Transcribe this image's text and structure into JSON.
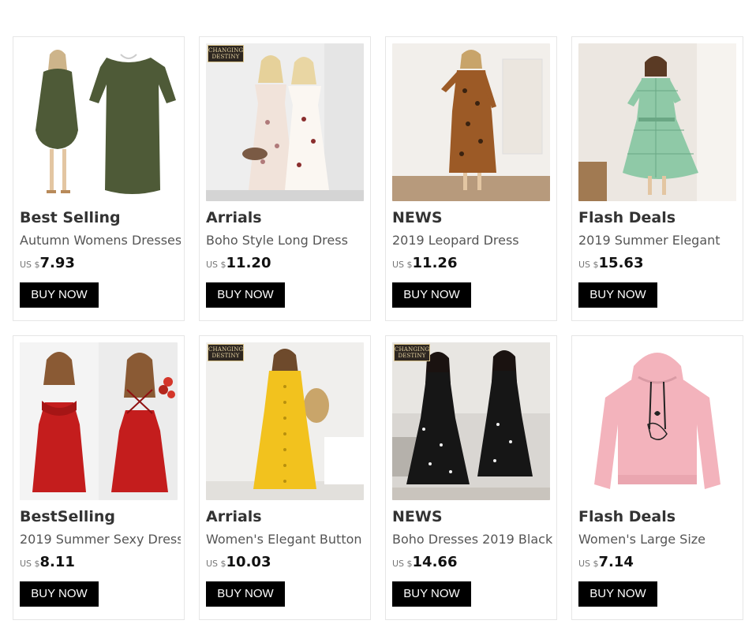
{
  "products": [
    {
      "category": "Best Selling",
      "title": "Autumn Womens Dresses",
      "currency": "US $",
      "price": "7.93",
      "button": "BUY NOW",
      "watermark": "",
      "image": "olive-dress-photo",
      "colors": {
        "bg": "#ffffff",
        "garment": "#4e5a37"
      }
    },
    {
      "category": "Arrials",
      "title": "Boho Style Long Dress",
      "currency": "US $",
      "price": "11.20",
      "button": "BUY NOW",
      "watermark": "CHANGING DESTINY",
      "image": "boho-dress-photo",
      "colors": {
        "bg": "#eeeeee",
        "garment": "#f1e3da"
      }
    },
    {
      "category": "NEWS",
      "title": "2019 Leopard Dress",
      "currency": "US $",
      "price": "11.26",
      "button": "BUY NOW",
      "watermark": "",
      "image": "leopard-dress-photo",
      "colors": {
        "bg": "#f2efeb",
        "garment": "#9c5a26"
      }
    },
    {
      "category": "Flash Deals",
      "title": "2019 Summer Elegant",
      "currency": "US $",
      "price": "15.63",
      "button": "BUY NOW",
      "watermark": "",
      "image": "plaid-dress-photo",
      "colors": {
        "bg": "#ece7e1",
        "garment": "#8fc9a7"
      }
    },
    {
      "category": "BestSelling",
      "title": "2019 Summer Sexy Dress",
      "currency": "US $",
      "price": "8.11",
      "button": "BUY NOW",
      "watermark": "",
      "image": "red-dress-photo",
      "colors": {
        "bg": "#ececec",
        "garment": "#c41d1d"
      }
    },
    {
      "category": "Arrials",
      "title": "Women's Elegant Button",
      "currency": "US $",
      "price": "10.03",
      "button": "BUY NOW",
      "watermark": "CHANGING DESTINY",
      "image": "yellow-dress-photo",
      "colors": {
        "bg": "#f0efed",
        "garment": "#f2c21e"
      }
    },
    {
      "category": "NEWS",
      "title": "Boho Dresses 2019 Black",
      "currency": "US $",
      "price": "14.66",
      "button": "BUY NOW",
      "watermark": "CHANGING DESTINY",
      "image": "black-floral-dress-photo",
      "colors": {
        "bg": "#d9d6d2",
        "garment": "#161616"
      }
    },
    {
      "category": "Flash Deals",
      "title": "Women's Large Size",
      "currency": "US $",
      "price": "7.14",
      "button": "BUY NOW",
      "watermark": "",
      "image": "pink-hoodie-photo",
      "colors": {
        "bg": "#ffffff",
        "garment": "#f3b3bc"
      }
    }
  ]
}
